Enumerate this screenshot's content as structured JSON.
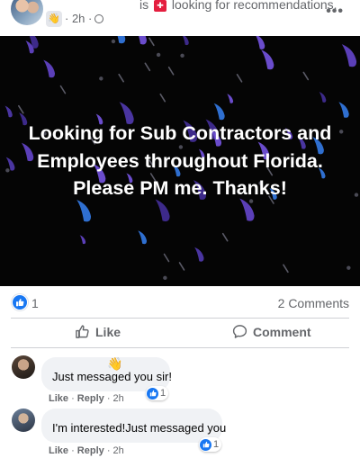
{
  "post": {
    "time": "2h",
    "activity_prefix": "is",
    "activity_text": "looking for recommendations.",
    "status_text": "Looking for Sub Contractors and Employees throughout Florida. Please PM me. Thanks!",
    "banner_bg": "#050505"
  },
  "reactions": {
    "count": "1",
    "comments": "2 Comments",
    "like_color": "#1877f2"
  },
  "actions": {
    "like": "Like",
    "comment": "Comment"
  },
  "comments": [
    {
      "text": "Just messaged you sir!",
      "like": "Like",
      "reply": "Reply",
      "time": "2h",
      "reactions": "1"
    },
    {
      "text": "I'm interested!Just messaged you",
      "like": "Like",
      "reply": "Reply",
      "time": "2h",
      "reactions": "1"
    }
  ]
}
